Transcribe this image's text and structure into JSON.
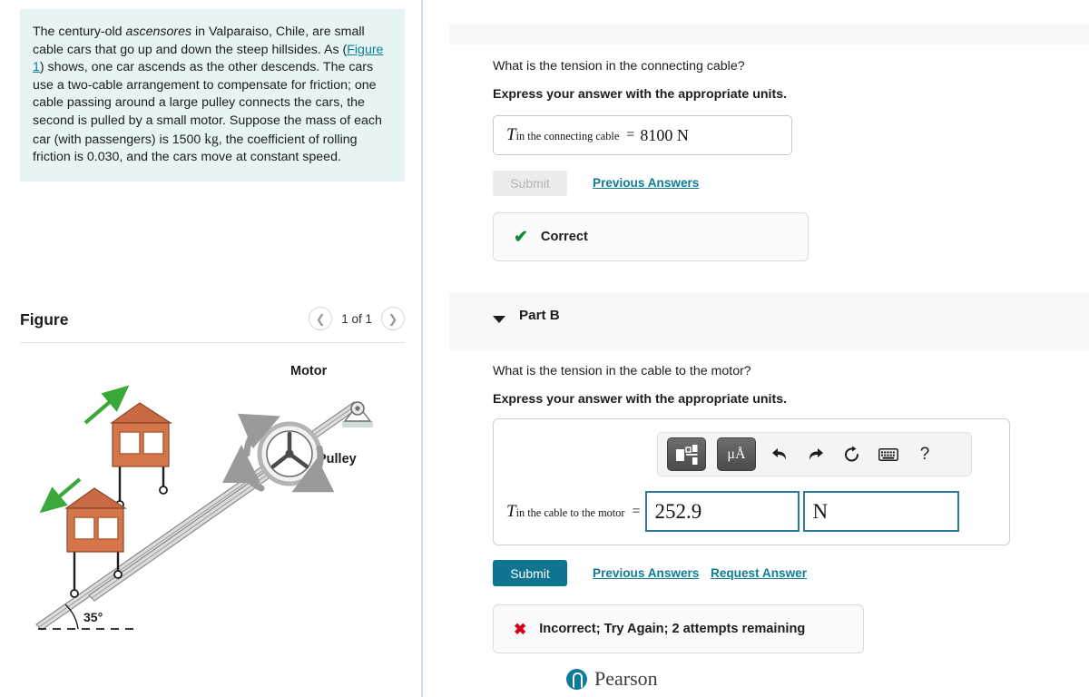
{
  "left": {
    "problem": {
      "part1": "The century-old ",
      "italic": "ascensores",
      "part2": " in Valparaiso, Chile, are small cable cars that go up and down the steep hillsides. As (",
      "figure_link": "Figure 1",
      "part3": ") shows, one car ascends as the other descends. The cars use a two-cable arrangement to compensate for friction; one cable passing around a large pulley connects the cars, the second is pulled by a small motor. Suppose the mass of each car (with passengers) is 1500 ",
      "mass_unit": "kg",
      "part4": ", the coefficient of rolling friction is 0.030, and the cars move at constant speed."
    },
    "figure": {
      "title": "Figure",
      "prev_icon": "chevron-left-icon",
      "count": "1 of 1",
      "next_icon": "chevron-right-icon",
      "labels": {
        "motor": "Motor",
        "pulley": "Pulley",
        "angle": "35°"
      }
    }
  },
  "right": {
    "part_a": {
      "question": "What is the tension in the connecting cable?",
      "instruction": "Express your answer with the appropriate units.",
      "answer": {
        "var_main": "T",
        "var_sub": "in the connecting cable",
        "equals": "=",
        "value": "8100 N"
      },
      "submit_label": "Submit",
      "previous_answers_label": "Previous Answers",
      "feedback": {
        "icon": "check-icon",
        "text": "Correct"
      }
    },
    "part_b": {
      "header_label": "Part B",
      "caret_icon": "caret-down-icon",
      "question": "What is the tension in the cable to the motor?",
      "instruction": "Express your answer with the appropriate units.",
      "toolbar": [
        {
          "name": "template-fraction-button",
          "glyph": ""
        },
        {
          "name": "units-button",
          "glyph": "μÅ"
        },
        {
          "name": "undo-button",
          "glyph": "↰"
        },
        {
          "name": "redo-button",
          "glyph": "↱"
        },
        {
          "name": "reset-button",
          "glyph": "↻"
        },
        {
          "name": "keyboard-button",
          "glyph": "⌨"
        },
        {
          "name": "help-button",
          "glyph": "?"
        }
      ],
      "answer": {
        "var_main": "T",
        "var_sub": "in the cable to the motor",
        "equals": "=",
        "value": "252.9",
        "unit": "N"
      },
      "submit_label": "Submit",
      "previous_answers_label": "Previous Answers",
      "request_answer_label": "Request Answer",
      "feedback": {
        "icon": "x-icon",
        "text": "Incorrect; Try Again; 2 attempts remaining"
      }
    },
    "footer": {
      "brand": "Pearson",
      "logo_icon": "pearson-p-icon"
    }
  },
  "colors": {
    "accent_teal": "#0e7490",
    "link": "#0f7c96",
    "problem_bg": "#e6f4f4",
    "band_bg": "#f8f8f8",
    "correct_green": "#138a36",
    "incorrect_red": "#d0021b",
    "input_border": "#2b7a9b",
    "car_orange": "#d4754a"
  }
}
